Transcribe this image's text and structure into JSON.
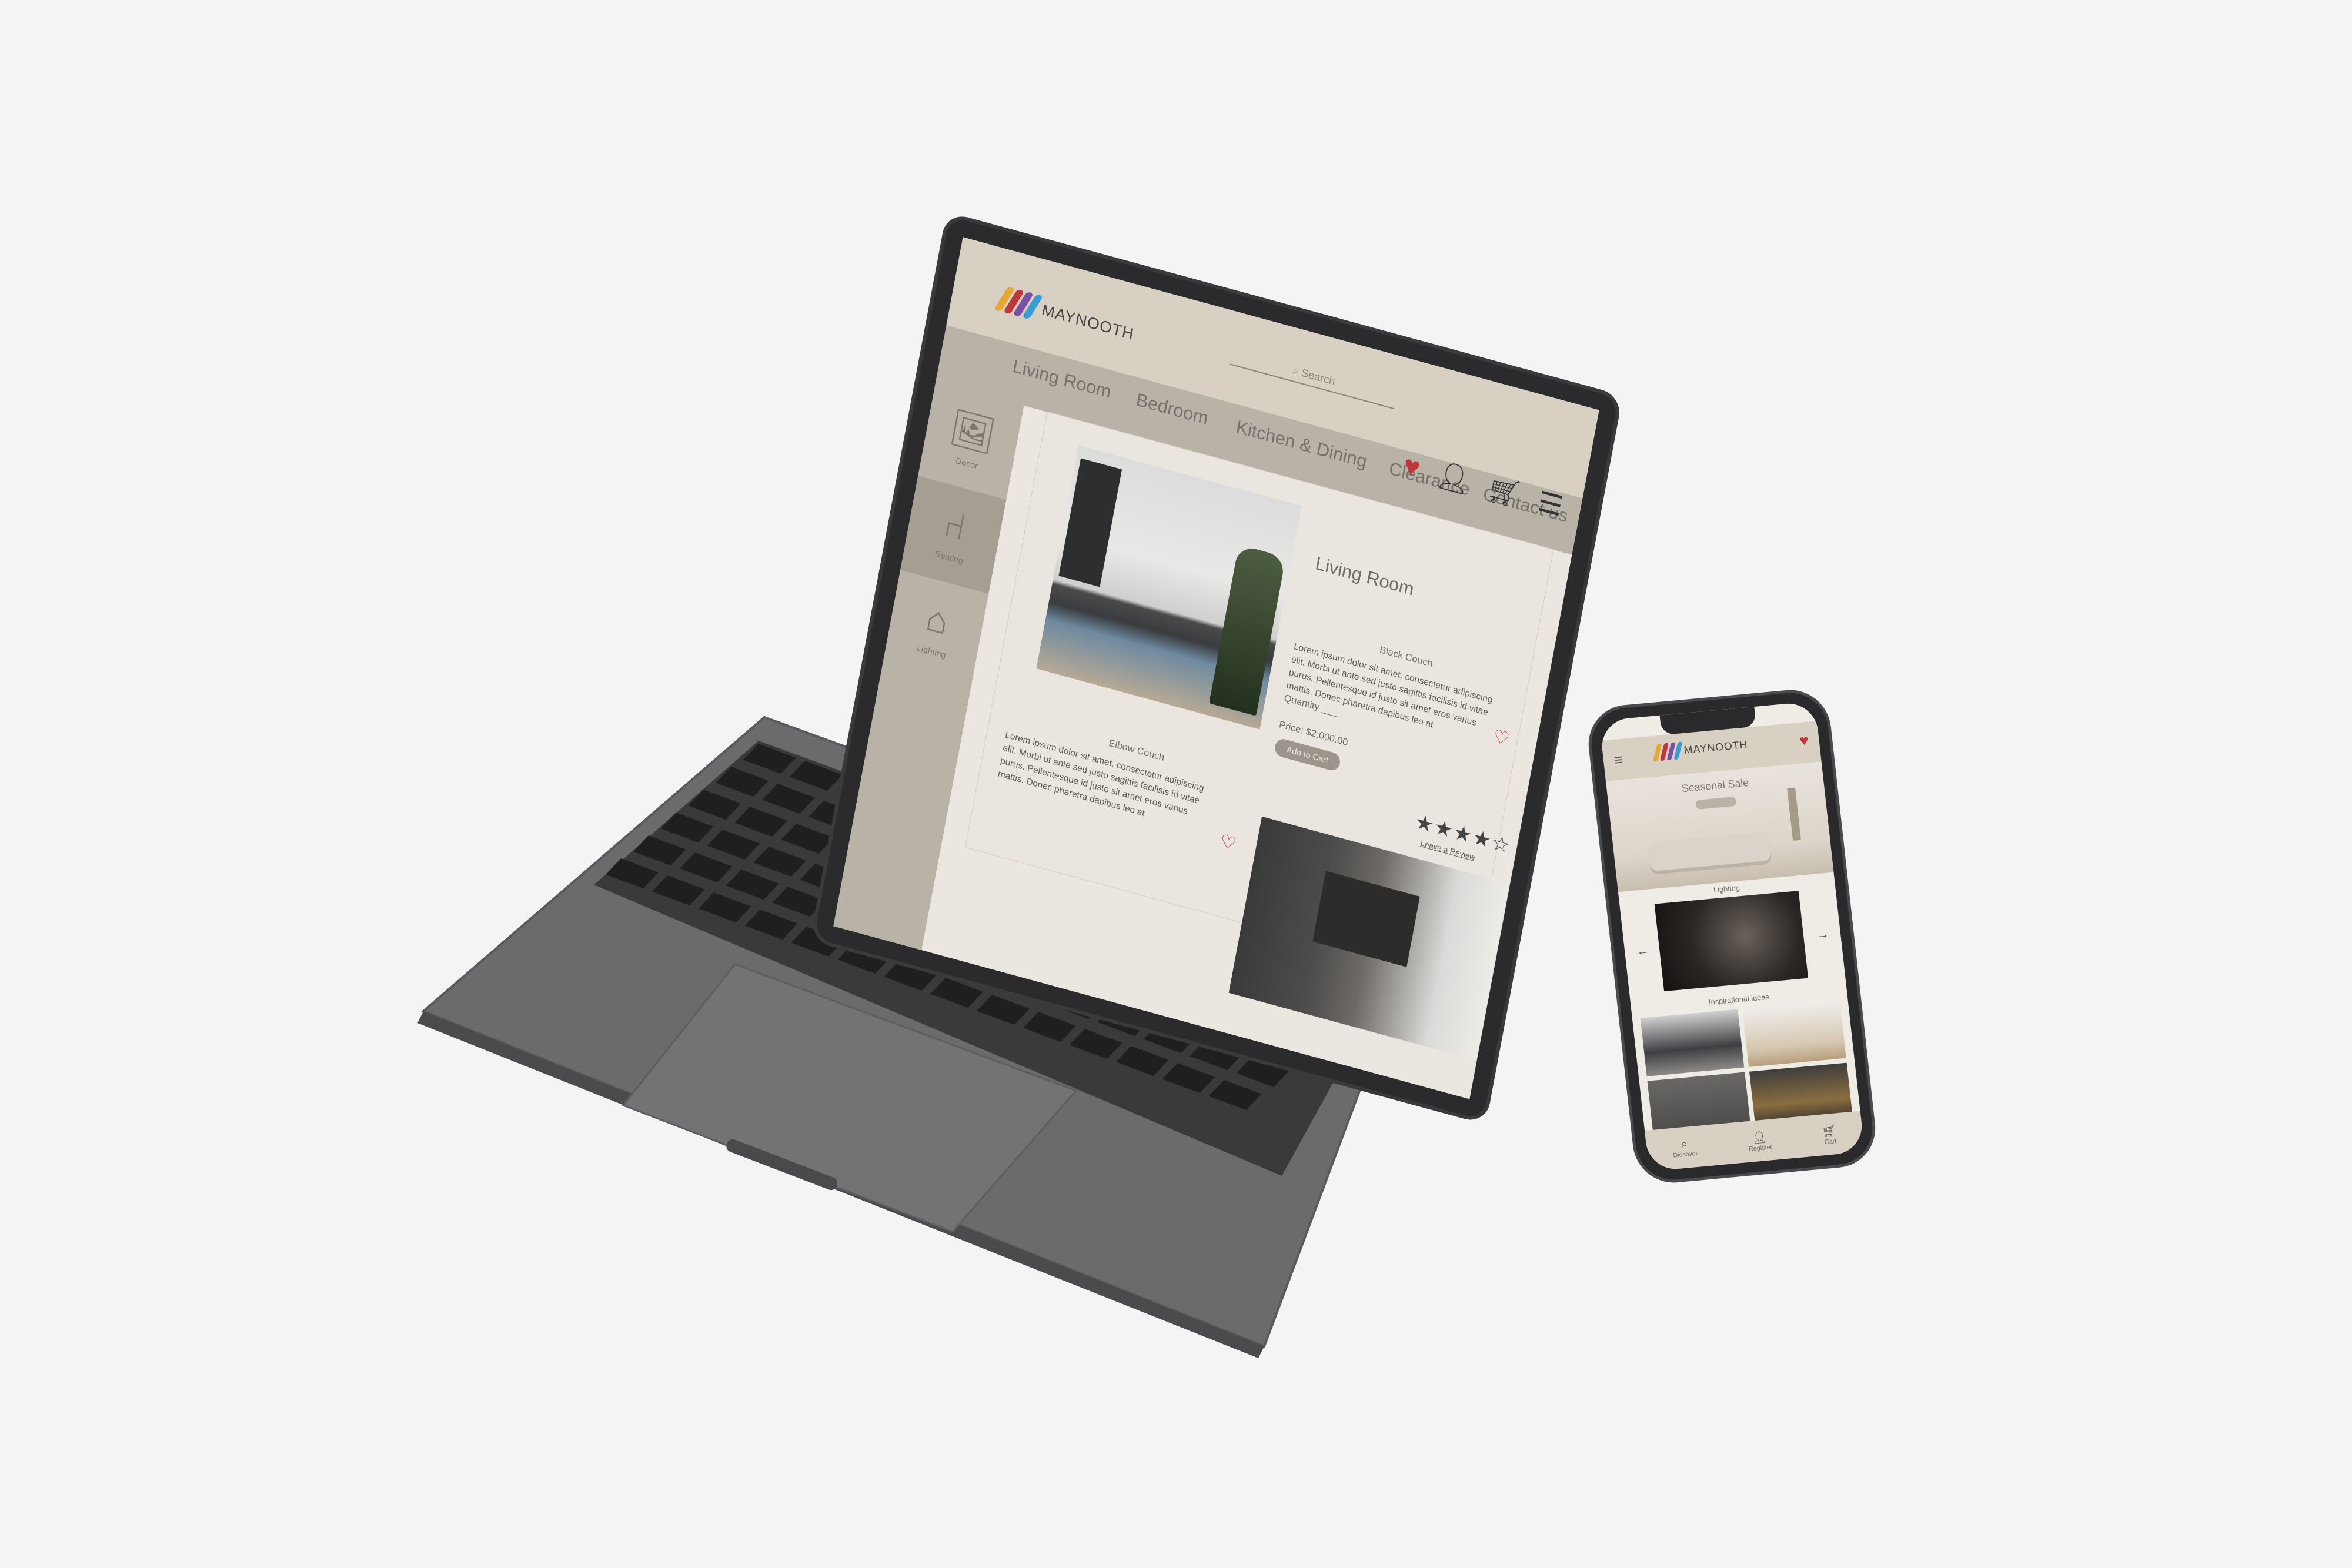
{
  "desktop": {
    "brand": "MAYNOOTH",
    "brand_colors": [
      "#e6a735",
      "#c0363d",
      "#7b4fa3",
      "#3a9bd1"
    ],
    "search_placeholder": "Search",
    "nav": [
      "Living Room",
      "Bedroom",
      "Kitchen & Dining",
      "Clearance",
      "Contact us"
    ],
    "icons": [
      "heart-icon",
      "user-icon",
      "cart-icon",
      "menu-icon"
    ],
    "sidebar": [
      {
        "label": "Decor",
        "icon": "picture-icon"
      },
      {
        "label": "Seating",
        "icon": "armchair-icon"
      },
      {
        "label": "Lighting",
        "icon": "lamp-icon"
      }
    ],
    "section_title": "Living Room",
    "product1": {
      "name": "Black Couch",
      "description": "Lorem ipsum dolor sit amet, consectetur adipiscing elit. Morbi ut ante sed justo sagittis facilisis id vitae purus. Pellentesque id justo sit amet eros varius mattis. Donec pharetra dapibus leo at",
      "quantity": "Quantity ___",
      "price": "Price: $2,000.00",
      "button": "Add to Cart"
    },
    "product2": {
      "name": "Elbow Couch",
      "description": "Lorem ipsum dolor sit amet, consectetur adipiscing elit. Morbi ut ante sed justo sagittis facilisis id vitae purus. Pellentesque id justo sit amet eros varius mattis. Donec pharetra dapibus leo at",
      "rating": "★★★★☆",
      "review_link": "Leave a Review"
    }
  },
  "mobile": {
    "brand": "MAYNOOTH",
    "banner_title": "Seasonal Sale",
    "section1": "Lighting",
    "section2": "Inspirational ideas",
    "tabs": [
      {
        "label": "Discover",
        "icon": "search-icon"
      },
      {
        "label": "Register",
        "icon": "user-icon"
      },
      {
        "label": "Cart",
        "icon": "cart-icon"
      }
    ]
  }
}
